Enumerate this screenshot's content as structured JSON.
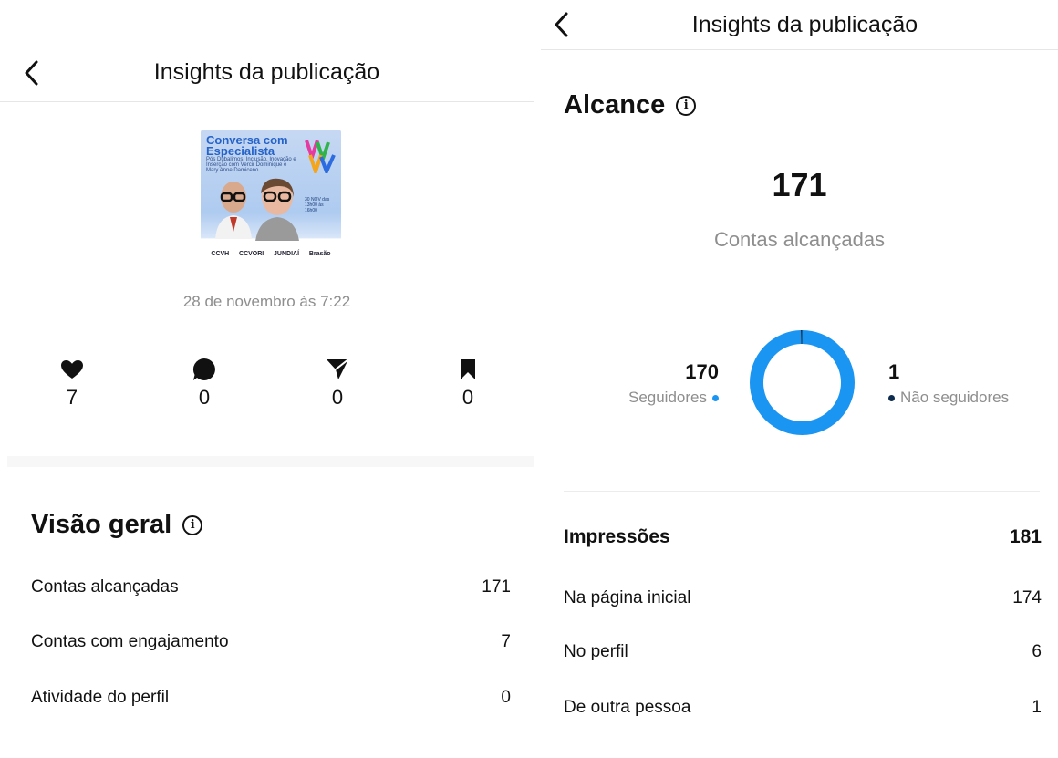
{
  "left": {
    "header_title": "Insights da publicação",
    "thumbnail": {
      "title": "Conversa com Especialista",
      "subtitle": "Pós Dubalimos, Inclusão, Inovação e Inserção com Vercir Dominique e Mary Anne Damiceno",
      "date_text": "30 NOV das 13h00 às 16h00",
      "logos": [
        "CCVH",
        "CCVORI",
        "JUNDIAÍ",
        "Brasão"
      ]
    },
    "post_date": "28 de novembro às 7:22",
    "stats": [
      {
        "icon": "heart-icon",
        "value": "7"
      },
      {
        "icon": "comment-icon",
        "value": "0"
      },
      {
        "icon": "share-icon",
        "value": "0"
      },
      {
        "icon": "bookmark-icon",
        "value": "0"
      }
    ],
    "overview": {
      "title": "Visão geral",
      "rows": [
        {
          "label": "Contas alcançadas",
          "value": "171"
        },
        {
          "label": "Contas com engajamento",
          "value": "7"
        },
        {
          "label": "Atividade do perfil",
          "value": "0"
        }
      ]
    }
  },
  "right": {
    "header_title": "Insights da publicação",
    "reach": {
      "title": "Alcance",
      "total": "171",
      "total_label": "Contas alcançadas",
      "followers_value": "170",
      "followers_label": "Seguidores",
      "non_followers_value": "1",
      "non_followers_label": "Não seguidores",
      "followers_fraction": 0.9942,
      "followers_color": "#1b95f2",
      "non_followers_color": "#0d2b4e"
    },
    "impressions": {
      "title": "Impressões",
      "total": "181",
      "rows": [
        {
          "label": "Na página inicial",
          "value": "174"
        },
        {
          "label": "No perfil",
          "value": "6"
        },
        {
          "label": "De outra pessoa",
          "value": "1"
        }
      ]
    }
  }
}
